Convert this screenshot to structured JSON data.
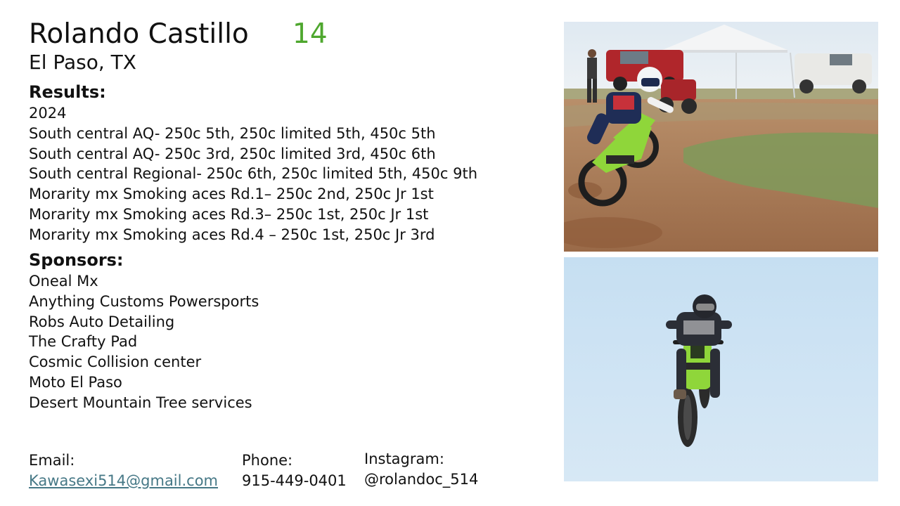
{
  "header": {
    "name": "Rolando Castillo",
    "number": "14",
    "location": "El Paso, TX"
  },
  "results": {
    "title": "Results:",
    "lines": [
      "2024",
      "South central AQ- 250c 5th, 250c limited 5th, 450c 5th",
      "South central AQ- 250c 3rd, 250c limited 3rd, 450c 6th",
      "South central Regional- 250c 6th, 250c limited 5th, 450c 9th",
      "Morarity mx Smoking aces Rd.1– 250c 2nd, 250c Jr 1st",
      "Morarity mx Smoking aces Rd.3– 250c 1st, 250c Jr 1st",
      "Morarity mx Smoking aces Rd.4 – 250c 1st, 250c Jr 3rd"
    ]
  },
  "sponsors": {
    "title": "Sponsors:",
    "items": [
      "Oneal Mx",
      "Anything Customs Powersports",
      "Robs Auto Detailing",
      "The Crafty Pad",
      "Cosmic Collision center",
      "Moto El Paso",
      "Desert Mountain Tree services"
    ]
  },
  "contact": {
    "email_label": "Email:",
    "email": "Kawasexi514@gmail.com",
    "phone_label": "Phone:",
    "phone": "915-449-0401",
    "instagram_label": "Instagram:",
    "instagram": "@rolandoc_514"
  },
  "colors": {
    "number": "#4ea72e",
    "link": "#467886",
    "bike_green": "#8fd63a"
  }
}
